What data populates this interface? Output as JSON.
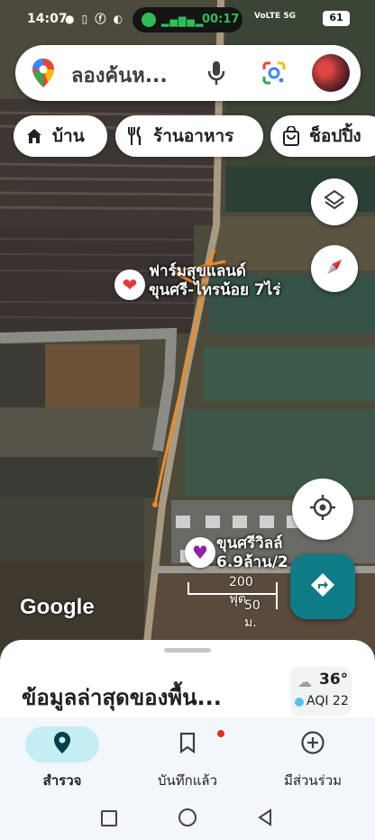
{
  "status_bar": {
    "time": "14:07",
    "call_duration": "00:17",
    "network": "VoLTE 5G",
    "battery": "61"
  },
  "search": {
    "placeholder": "ลองค้นห..."
  },
  "chips": [
    {
      "label": "บ้าน",
      "icon": "home-icon"
    },
    {
      "label": "ร้านอาหาร",
      "icon": "restaurant-icon"
    },
    {
      "label": "ช็อปปิ้ง",
      "icon": "shopping-bag-icon"
    }
  ],
  "places": {
    "farm_line1": "ฟาร์มสุขแลนด์",
    "farm_line2": "ขุนศรี-ไทรน้อย 7ไร่",
    "villa_line1": "ขุนศรีวิลล์",
    "villa_line2": "6.9ล้าน/2"
  },
  "map": {
    "logo": "Google",
    "scale_ft": "200 ฟุต",
    "scale_m": "50 ม."
  },
  "sheet": {
    "title": "ข้อมูลล่าสุดของพื้น...",
    "temperature": "36°",
    "aqi": "AQI 22"
  },
  "nav": [
    {
      "label": "สำรวจ",
      "icon": "explore-pin-icon",
      "active": true
    },
    {
      "label": "บันทึกแล้ว",
      "icon": "bookmark-icon",
      "active": false
    },
    {
      "label": "มีส่วนร่วม",
      "icon": "add-circle-icon",
      "active": false
    }
  ],
  "colors": {
    "accent": "#0e7c86",
    "annotation": "#f08a24",
    "active_nav": "#c6ecf4"
  }
}
